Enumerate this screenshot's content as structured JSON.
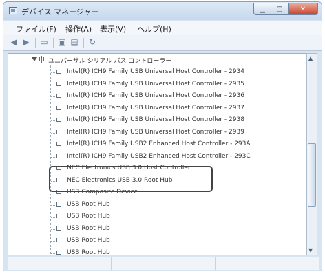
{
  "window": {
    "title": "デバイス マネージャー"
  },
  "menu": [
    {
      "label": "ファイル(F)"
    },
    {
      "label": "操作(A)"
    },
    {
      "label": "表示(V)"
    },
    {
      "label": "ヘルプ(H)"
    }
  ],
  "toolbar": {
    "back_icon": "back-arrow-icon",
    "forward_icon": "forward-arrow-icon",
    "buttons": [
      "properties-icon",
      "view-icon",
      "help-icon",
      "scan-hardware-icon"
    ]
  },
  "tree": {
    "root": {
      "label": "ユニバーサル シリアル バス コントローラー",
      "icon": "usb-icon",
      "expanded": true
    },
    "items": [
      {
        "label": "Intel(R) ICH9 Family USB Universal Host Controller - 2934"
      },
      {
        "label": "Intel(R) ICH9 Family USB Universal Host Controller - 2935"
      },
      {
        "label": "Intel(R) ICH9 Family USB Universal Host Controller - 2936"
      },
      {
        "label": "Intel(R) ICH9 Family USB Universal Host Controller - 2937"
      },
      {
        "label": "Intel(R) ICH9 Family USB Universal Host Controller - 2938"
      },
      {
        "label": "Intel(R) ICH9 Family USB Universal Host Controller - 2939"
      },
      {
        "label": "Intel(R) ICH9 Family USB2 Enhanced Host Controller - 293A"
      },
      {
        "label": "Intel(R) ICH9 Family USB2 Enhanced Host Controller - 293C"
      },
      {
        "label": "NEC Electronics USB 3.0 Host Controller"
      },
      {
        "label": "NEC Electronics USB 3.0 Root Hub"
      },
      {
        "label": "USB Composite Device"
      },
      {
        "label": "USB Root Hub"
      },
      {
        "label": "USB Root Hub"
      },
      {
        "label": "USB Root Hub"
      },
      {
        "label": "USB Root Hub"
      },
      {
        "label": "USB Root Hub"
      }
    ]
  },
  "colors": {
    "title_bar": "#c6d8ec",
    "close_button": "#c9432c",
    "highlight_border": "#444444"
  }
}
